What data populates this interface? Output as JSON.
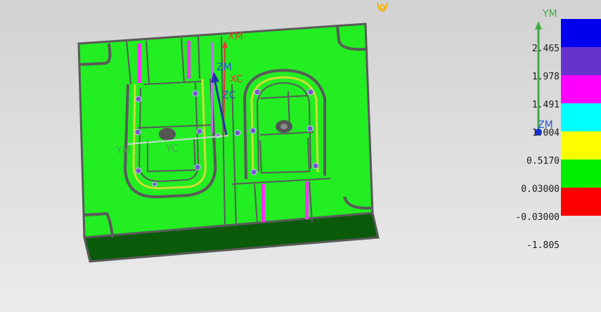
{
  "colors": {
    "background_top": "#d2d2d2",
    "background_bottom": "#ebebeb",
    "mold_face": "#22ee22",
    "mold_side": "#0a5a0a",
    "edge": "#5a5a5a",
    "legend": [
      "#0000ee",
      "#6633cc",
      "#ff00ff",
      "#00ffff",
      "#ffff00",
      "#00ee00",
      "#ff0000"
    ]
  },
  "legend_values": [
    "2.465",
    "1.978",
    "1.491",
    "1.004",
    "0.5170",
    "0.03000",
    "-0.03000",
    "-1.805"
  ],
  "triad": {
    "ym": "YM",
    "zm_legend": "ZM",
    "xm": "XM",
    "zm": "ZM",
    "xc": "XC",
    "zc": "ZC",
    "ym_model": "YM",
    "yc": "YC"
  },
  "icons": {
    "orientation": "orient-icon"
  }
}
